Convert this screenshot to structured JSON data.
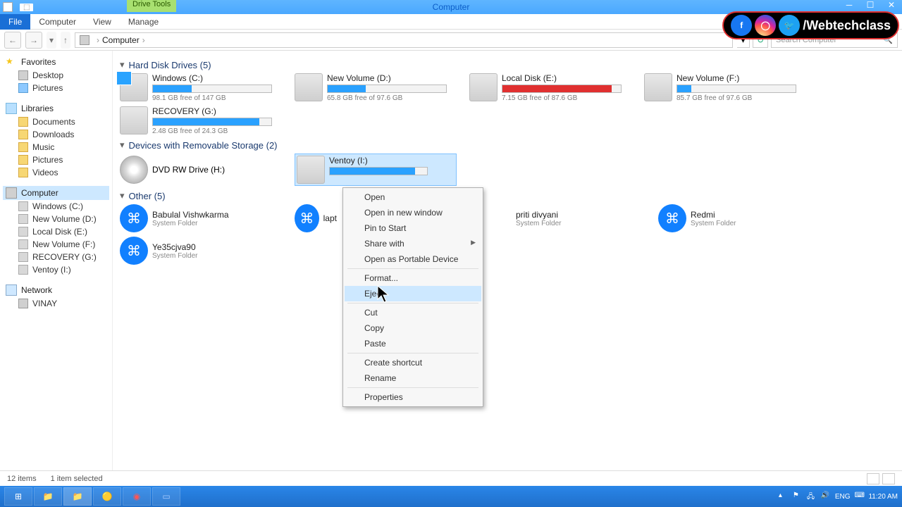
{
  "title": {
    "drive_tools": "Drive Tools",
    "center": "Computer"
  },
  "ribbon": {
    "file": "File",
    "tabs": [
      "Computer",
      "View",
      "Manage"
    ]
  },
  "address": {
    "path": "Computer",
    "search_placeholder": "Search Computer"
  },
  "sidebar": {
    "favorites": {
      "label": "Favorites",
      "items": [
        {
          "label": "Desktop"
        },
        {
          "label": "Pictures"
        }
      ]
    },
    "libraries": {
      "label": "Libraries",
      "items": [
        {
          "label": "Documents"
        },
        {
          "label": "Downloads"
        },
        {
          "label": "Music"
        },
        {
          "label": "Pictures"
        },
        {
          "label": "Videos"
        }
      ]
    },
    "computer": {
      "label": "Computer",
      "items": [
        {
          "label": "Windows (C:)"
        },
        {
          "label": "New Volume (D:)"
        },
        {
          "label": "Local Disk (E:)"
        },
        {
          "label": "New Volume (F:)"
        },
        {
          "label": "RECOVERY (G:)"
        },
        {
          "label": "Ventoy (I:)"
        }
      ]
    },
    "network": {
      "label": "Network",
      "items": [
        {
          "label": "VINAY"
        }
      ]
    }
  },
  "sections": {
    "hdd": {
      "title": "Hard Disk Drives (5)",
      "drives": [
        {
          "name": "Windows (C:)",
          "free": "98.1 GB free of 147 GB",
          "pct": 33,
          "cls": "windows"
        },
        {
          "name": "New Volume (D:)",
          "free": "65.8 GB free of 97.6 GB",
          "pct": 32
        },
        {
          "name": "Local Disk (E:)",
          "free": "7.15 GB free of 87.6 GB",
          "pct": 92,
          "red": true
        },
        {
          "name": "New Volume (F:)",
          "free": "85.7 GB free of 97.6 GB",
          "pct": 12
        },
        {
          "name": "RECOVERY (G:)",
          "free": "2.48 GB free of 24.3 GB",
          "pct": 90
        }
      ]
    },
    "removable": {
      "title": "Devices with Removable Storage (2)",
      "dvd": {
        "name": "DVD RW Drive (H:)"
      },
      "ventoy": {
        "name": "Ventoy (I:)",
        "pct": 88
      }
    },
    "other": {
      "title": "Other (5)",
      "items": [
        {
          "name": "Babulal Vishwkarma",
          "type": "System Folder"
        },
        {
          "name": "lapt",
          "type": ""
        },
        {
          "name": "priti divyani",
          "type": "System Folder"
        },
        {
          "name": "Redmi",
          "type": "System Folder"
        },
        {
          "name": "Ye35cjva90",
          "type": "System Folder"
        }
      ]
    }
  },
  "context_menu": [
    {
      "label": "Open"
    },
    {
      "label": "Open in new window"
    },
    {
      "label": "Pin to Start"
    },
    {
      "label": "Share with",
      "sub": true
    },
    {
      "label": "Open as Portable Device"
    },
    {
      "sep": true
    },
    {
      "label": "Format..."
    },
    {
      "label": "Eject",
      "hl": true
    },
    {
      "sep": true
    },
    {
      "label": "Cut"
    },
    {
      "label": "Copy"
    },
    {
      "label": "Paste"
    },
    {
      "sep": true
    },
    {
      "label": "Create shortcut"
    },
    {
      "label": "Rename"
    },
    {
      "sep": true
    },
    {
      "label": "Properties"
    }
  ],
  "statusbar": {
    "items_count": "12 items",
    "selected": "1 item selected"
  },
  "tray": {
    "lang": "ENG",
    "time": "11:20 AM"
  },
  "social": {
    "text": "/Webtechclass"
  }
}
